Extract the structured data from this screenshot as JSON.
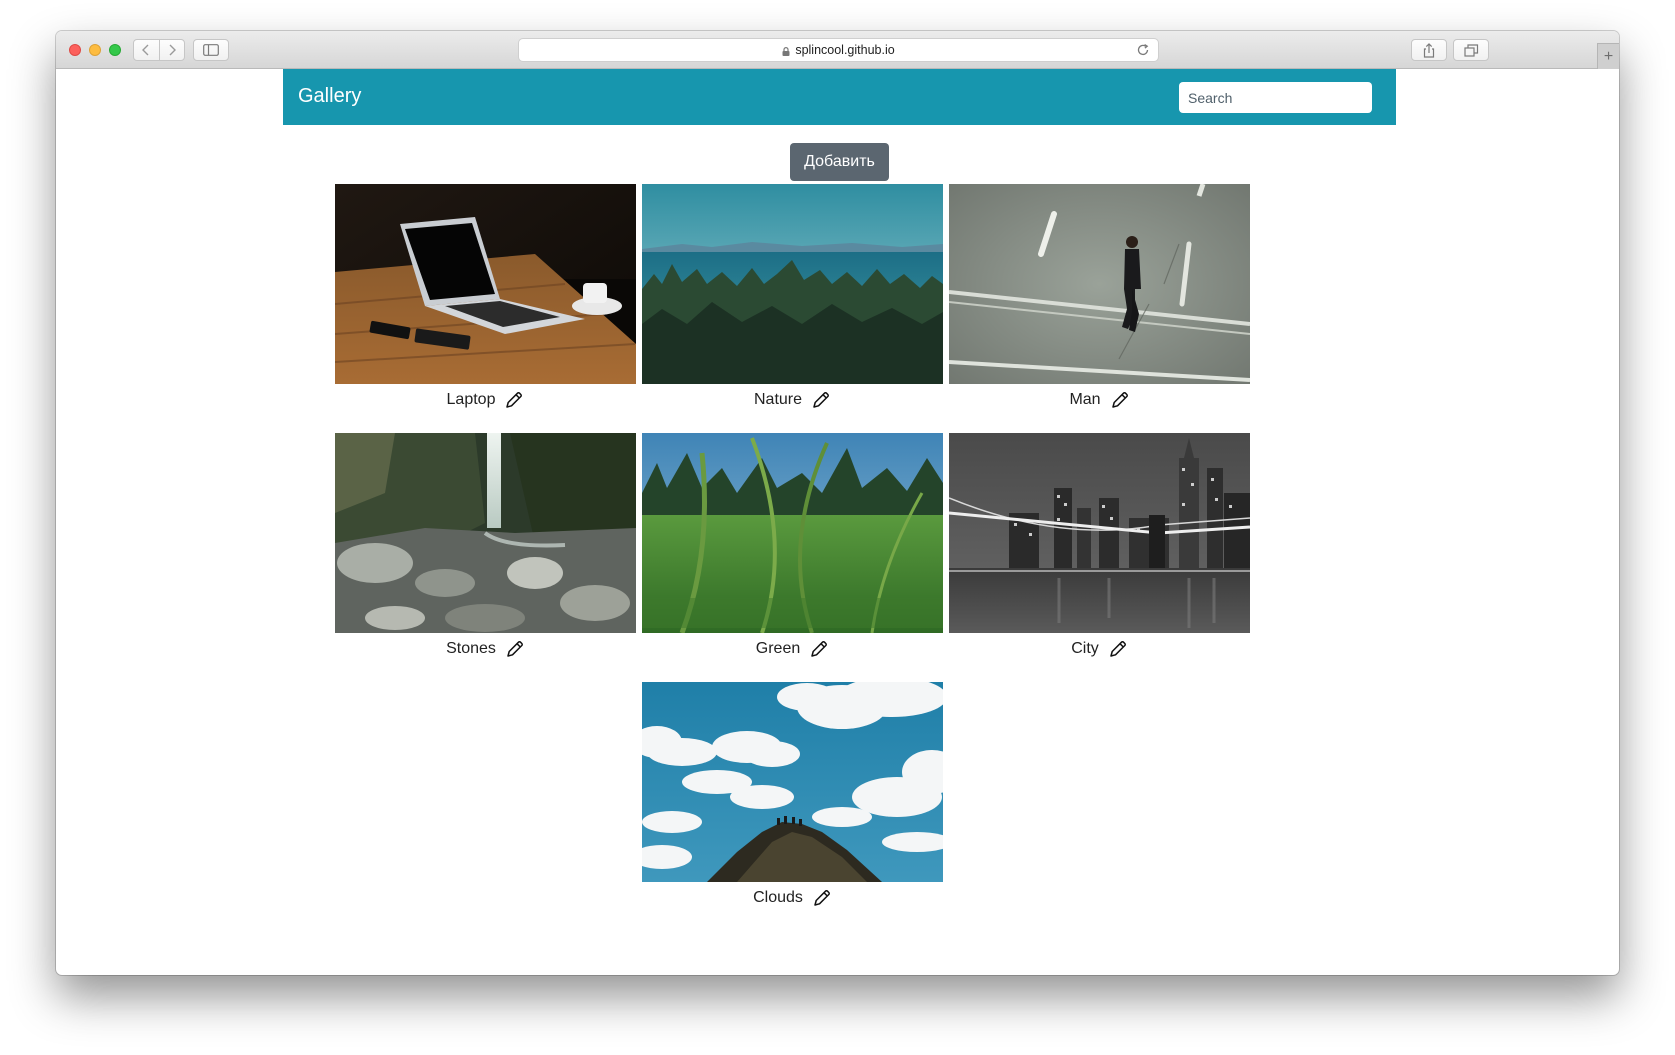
{
  "browser": {
    "url": "splincool.github.io",
    "new_tab_label": "+",
    "icons": [
      "back-icon",
      "forward-icon",
      "sidebar-icon",
      "lock-icon",
      "reload-icon",
      "share-icon",
      "tabs-icon"
    ]
  },
  "header": {
    "brand": "Gallery",
    "search_placeholder": "Search"
  },
  "add_button_label": "Добавить",
  "gallery": {
    "items": [
      {
        "title": "Laptop",
        "icon": "pencil-icon"
      },
      {
        "title": "Nature",
        "icon": "pencil-icon"
      },
      {
        "title": "Man",
        "icon": "pencil-icon"
      },
      {
        "title": "Stones",
        "icon": "pencil-icon"
      },
      {
        "title": "Green",
        "icon": "pencil-icon"
      },
      {
        "title": "City",
        "icon": "pencil-icon"
      },
      {
        "title": "Clouds",
        "icon": "pencil-icon"
      }
    ]
  },
  "colors": {
    "header_bg": "#1796ae",
    "button_bg": "#5b6670"
  }
}
